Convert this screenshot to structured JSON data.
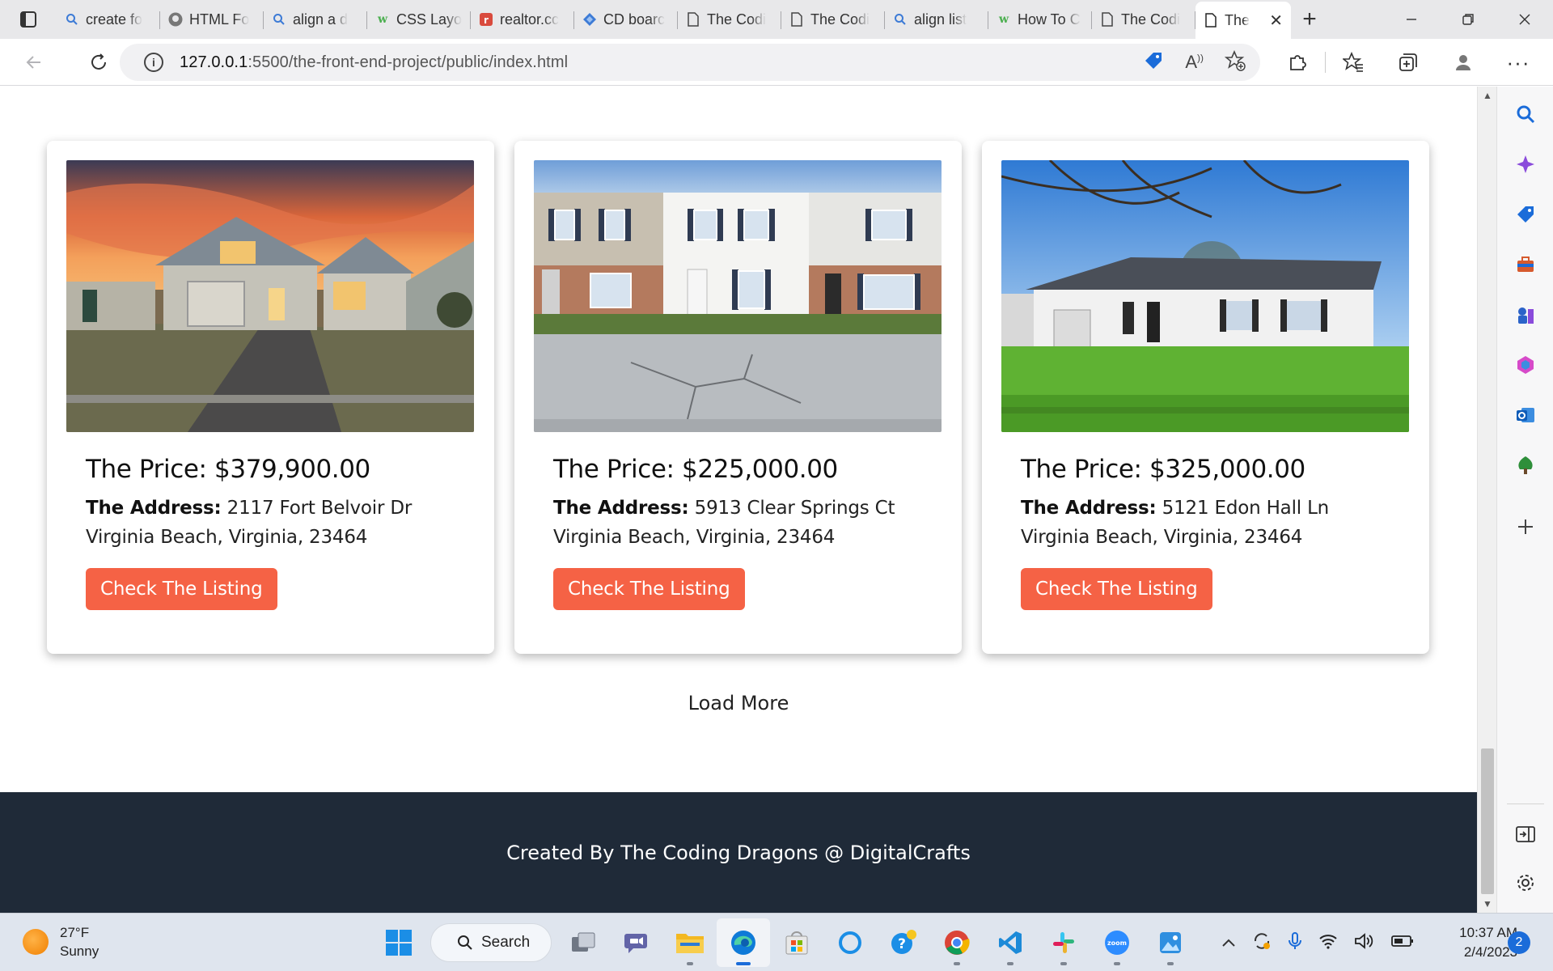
{
  "browser": {
    "tabs": [
      {
        "label": "create fo",
        "icon": "search-icon"
      },
      {
        "label": "HTML Fo",
        "icon": "github-icon"
      },
      {
        "label": "align a d",
        "icon": "search-icon"
      },
      {
        "label": "CSS Layo",
        "icon": "w3schools-icon"
      },
      {
        "label": "realtor.cc",
        "icon": "realtor-icon"
      },
      {
        "label": "CD boarc",
        "icon": "diamond-icon"
      },
      {
        "label": "The Codi",
        "icon": "page-icon"
      },
      {
        "label": "The Codi",
        "icon": "page-icon"
      },
      {
        "label": "align list",
        "icon": "search-icon"
      },
      {
        "label": "How To C",
        "icon": "w3schools-icon"
      },
      {
        "label": "The Codi",
        "icon": "page-icon"
      }
    ],
    "active_tab": {
      "label": "The",
      "icon": "page-icon"
    },
    "url_host": "127.0.0.1",
    "url_path": ":5500/the-front-end-project/public/index.html"
  },
  "listings": [
    {
      "price_label": "The Price:",
      "price": "$379,900.00",
      "address_label": "The Address:",
      "address": "2117 Fort Belvoir Dr Virginia Beach, Virginia, 23464",
      "button": "Check The Listing"
    },
    {
      "price_label": "The Price:",
      "price": "$225,000.00",
      "address_label": "The Address:",
      "address": "5913 Clear Springs Ct Virginia Beach, Virginia, 23464",
      "button": "Check The Listing"
    },
    {
      "price_label": "The Price:",
      "price": "$325,000.00",
      "address_label": "The Address:",
      "address": "5121 Edon Hall Ln Virginia Beach, Virginia, 23464",
      "button": "Check The Listing"
    }
  ],
  "load_more": "Load More",
  "footer": "Created By The Coding Dragons @ DigitalCrafts",
  "taskbar": {
    "temperature": "27°F",
    "condition": "Sunny",
    "search_label": "Search",
    "time": "10:37 AM",
    "date": "2/4/2023",
    "notification_count": "2"
  },
  "colors": {
    "cta": "#f56245",
    "footer_bg": "#1f2a38",
    "tabstrip_bg": "#e8e8ea"
  }
}
